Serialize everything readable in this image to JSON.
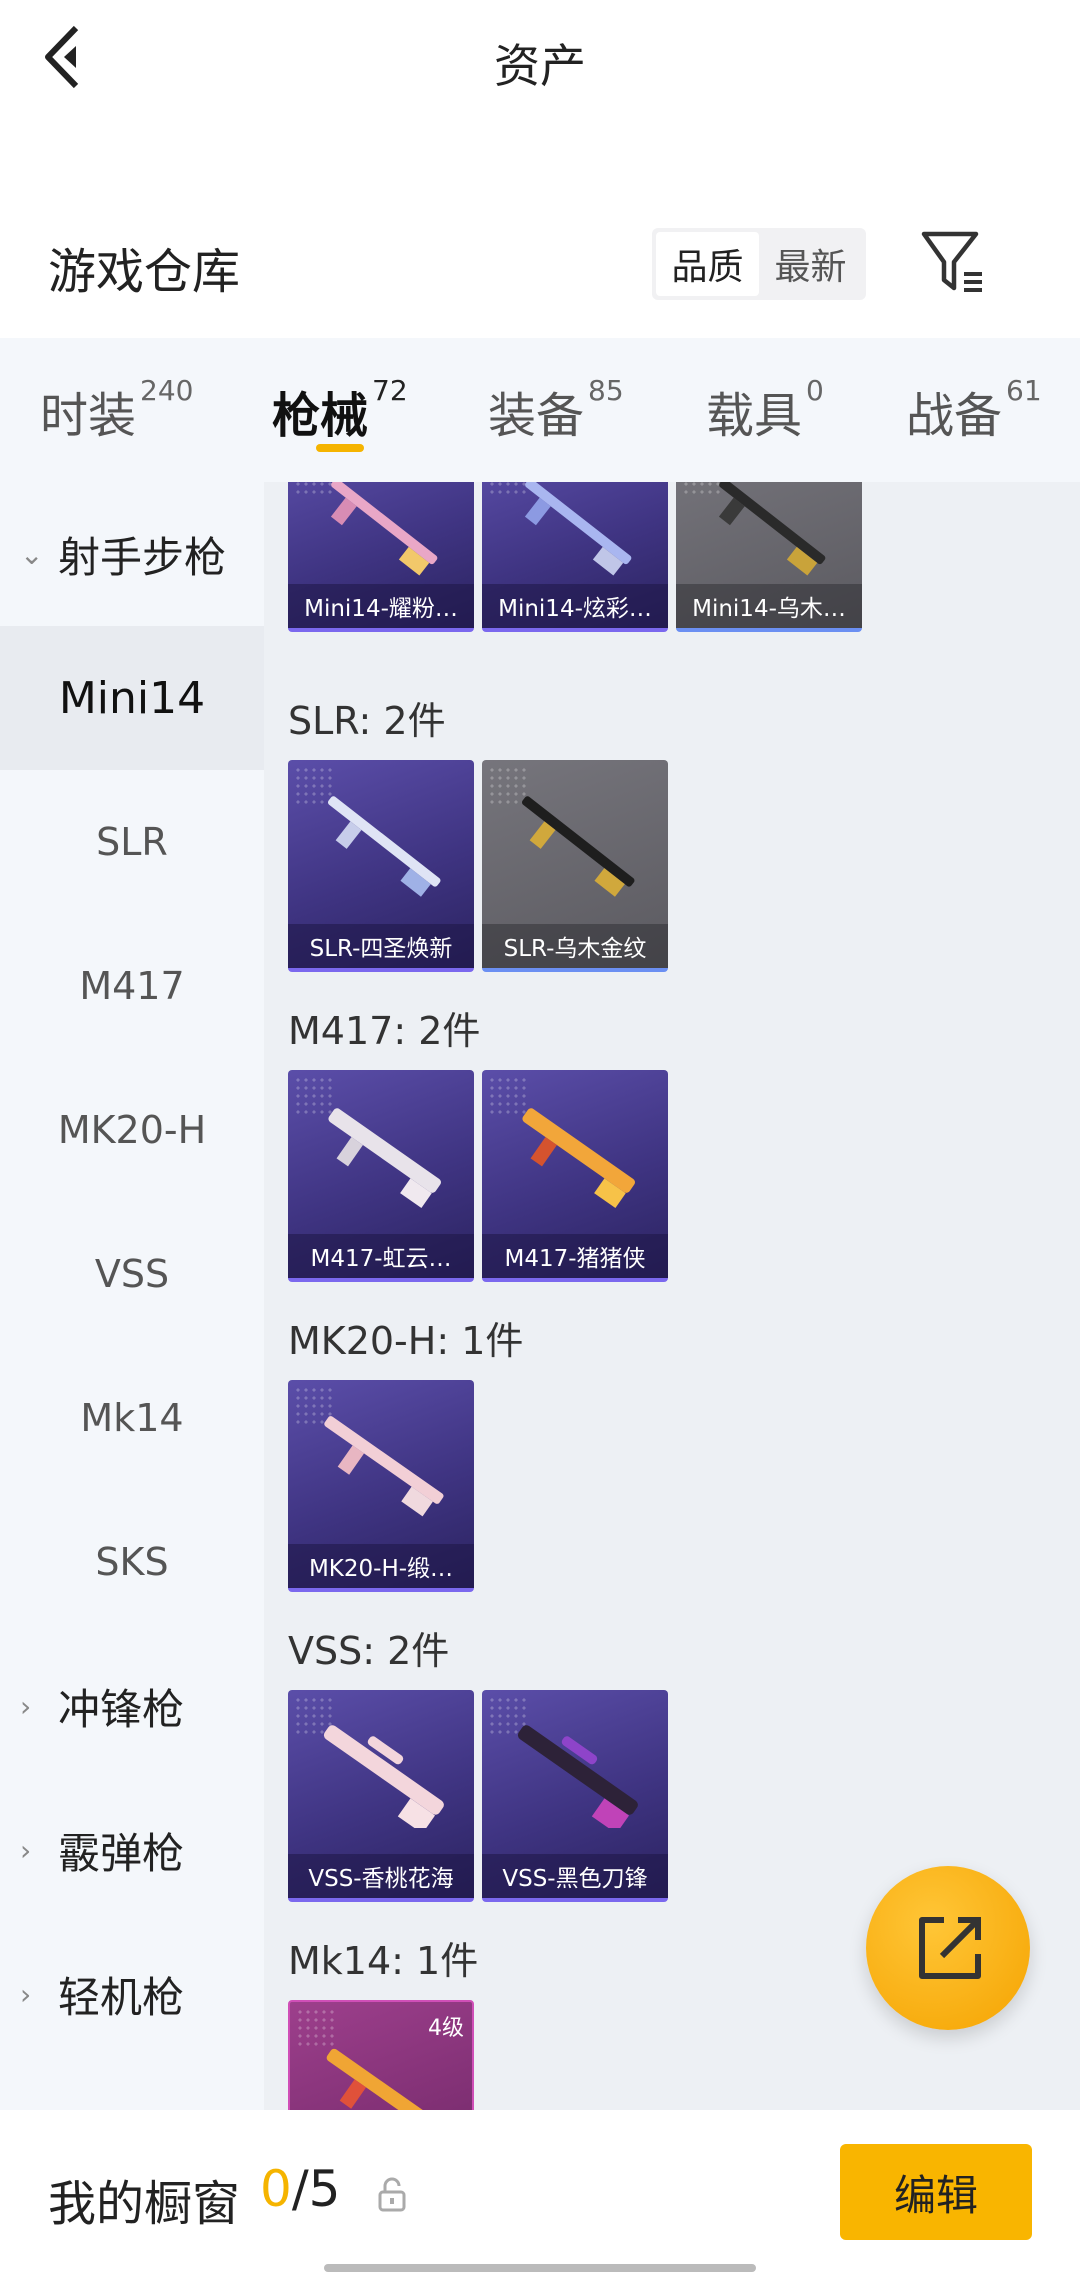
{
  "header": {
    "title": "资产"
  },
  "warehouse": {
    "title": "游戏仓库",
    "sort_options": [
      "品质",
      "最新"
    ],
    "active_sort": "品质"
  },
  "tabs": [
    {
      "label": "时装",
      "count": "240"
    },
    {
      "label": "枪械",
      "count": "72",
      "active": true
    },
    {
      "label": "装备",
      "count": "85"
    },
    {
      "label": "载具",
      "count": "0"
    },
    {
      "label": "战备",
      "count": "61"
    }
  ],
  "sidebar": {
    "category_open": "射手步枪",
    "items": [
      "Mini14",
      "SLR",
      "M417",
      "MK20-H",
      "VSS",
      "Mk14",
      "SKS"
    ],
    "active_item": "Mini14",
    "other_categories": [
      "冲锋枪",
      "霰弹枪",
      "轻机枪"
    ]
  },
  "sections": [
    {
      "title": "",
      "cards": [
        "Mini14-耀粉…",
        "Mini14-炫彩…",
        "Mini14-乌木…"
      ]
    },
    {
      "title": "SLR: 2件",
      "cards": [
        "SLR-四圣焕新",
        "SLR-乌木金纹"
      ]
    },
    {
      "title": "M417: 2件",
      "cards": [
        "M417-虹云…",
        "M417-猪猪侠"
      ]
    },
    {
      "title": "MK20-H: 1件",
      "cards": [
        "MK20-H-缎…"
      ]
    },
    {
      "title": "VSS: 2件",
      "cards": [
        "VSS-香桃花海",
        "VSS-黑色刀锋"
      ]
    },
    {
      "title": "Mk14: 1件",
      "cards": [
        ""
      ],
      "level": "4级"
    }
  ],
  "bottom": {
    "label": "我的橱窗",
    "current": "0",
    "separator": "/5",
    "edit": "编辑"
  },
  "colors": {
    "accent": "#f5b400",
    "card_purple": "#3f3482",
    "card_gray": "#5b5a60"
  }
}
